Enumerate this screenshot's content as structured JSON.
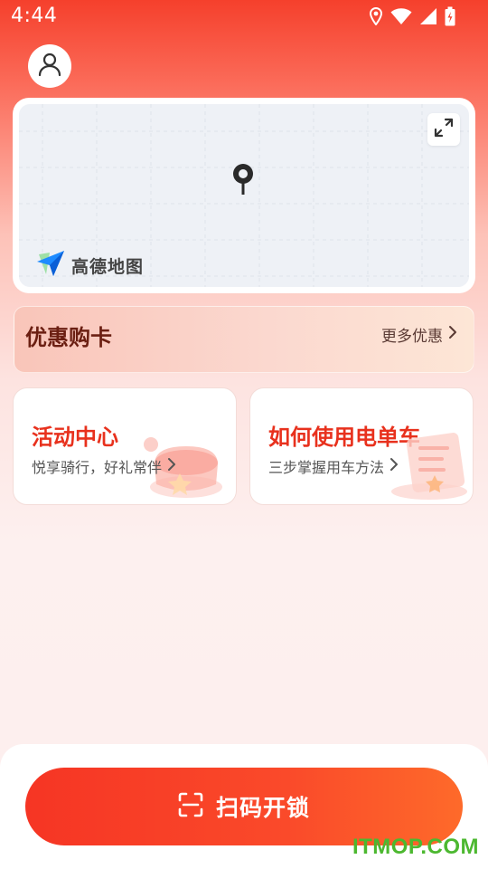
{
  "status_bar": {
    "time": "4:44",
    "icons": [
      "location-icon",
      "wifi-icon",
      "signal-icon",
      "battery-icon"
    ]
  },
  "header": {
    "avatar_icon": "user-icon"
  },
  "map": {
    "logo_text": "高德地图",
    "expand_icon": "expand-icon",
    "pin_icon": "map-pin-icon"
  },
  "promo": {
    "title": "优惠购卡",
    "more_label": "更多优惠"
  },
  "features": [
    {
      "title": "活动中心",
      "subtitle": "悦享骑行，好礼常伴"
    },
    {
      "title": "如何使用电单车",
      "subtitle": "三步掌握用车方法"
    }
  ],
  "action": {
    "scan_label": "扫码开锁",
    "scan_icon": "scan-icon"
  },
  "watermark": "ITMOP.COM",
  "colors": {
    "accent": "#f63524",
    "title_red": "#e8311d",
    "promo_text": "#6b1f12",
    "watermark": "#4cb830"
  }
}
